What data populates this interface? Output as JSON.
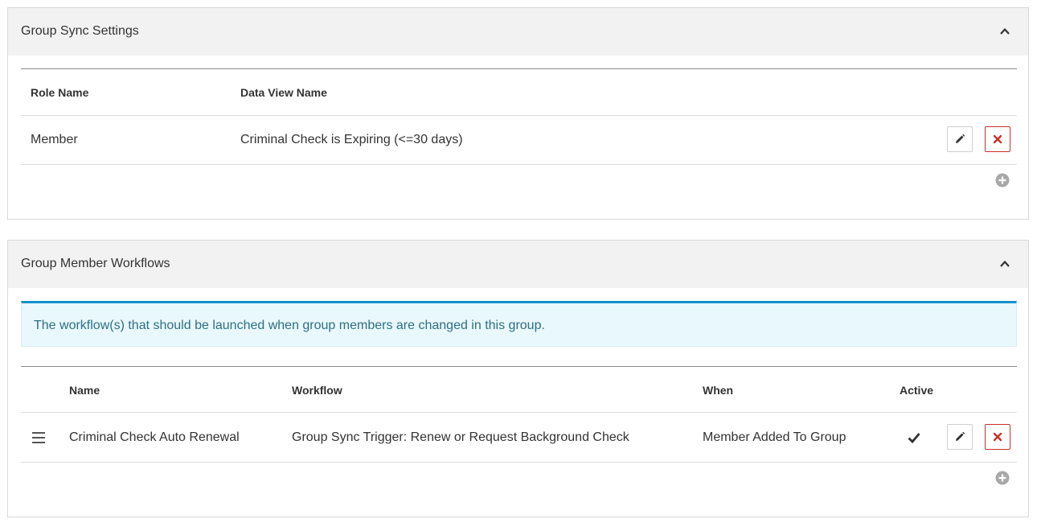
{
  "group_sync": {
    "title": "Group Sync Settings",
    "columns": {
      "role_name": "Role Name",
      "data_view_name": "Data View Name"
    },
    "rows": [
      {
        "role_name": "Member",
        "data_view_name": "Criminal Check is Expiring (<=30 days)"
      }
    ],
    "icons": {
      "collapse": "chevron-up-icon",
      "edit": "pencil-icon",
      "delete": "close-icon",
      "add": "plus-circle-icon"
    }
  },
  "member_workflows": {
    "title": "Group Member Workflows",
    "info_text": "The workflow(s) that should be launched when group members are changed in this group.",
    "columns": {
      "name": "Name",
      "workflow": "Workflow",
      "when": "When",
      "active": "Active"
    },
    "rows": [
      {
        "name": "Criminal Check Auto Renewal",
        "workflow": "Group Sync Trigger: Renew or Request Background Check",
        "when": "Member Added To Group",
        "active": true
      }
    ],
    "icons": {
      "collapse": "chevron-up-icon",
      "reorder": "drag-handle-icon",
      "active": "check-icon",
      "edit": "pencil-icon",
      "delete": "close-icon",
      "add": "plus-circle-icon"
    }
  },
  "colors": {
    "heading_bg": "#f2f2f2",
    "info_border": "#1391cc",
    "info_bg": "#e9f8fc",
    "info_text": "#2e6f86",
    "delete_red": "#c9302c",
    "add_icon": "#a8a8a8"
  }
}
